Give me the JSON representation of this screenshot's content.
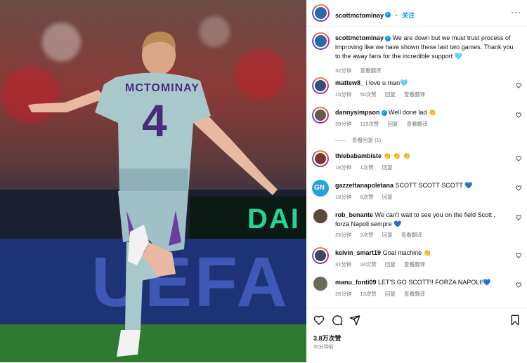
{
  "post": {
    "author": "scottmctominay",
    "follow_label": "关注",
    "caption": "We are down but we must trust process of improving like we have shown these last two games. Thank you to the away fans for the incredible support 🩵",
    "caption_time": "32分钟",
    "caption_translate": "查看翻译",
    "likes": "3.8万次赞",
    "time_ago": "32分钟前"
  },
  "photo": {
    "shirt_name": "MCTOMINAY",
    "shirt_number": "4",
    "board_text": "DAI",
    "ad_text": "UEFA"
  },
  "comments": [
    {
      "user": "mattew8_",
      "verified": false,
      "text": "i love u man🩵",
      "time": "15分钟",
      "likes": "50次赞",
      "reply": "回复",
      "translate": "查看翻译"
    },
    {
      "user": "dannysimpson",
      "verified": true,
      "text": "Well done lad 👏",
      "time": "28分钟",
      "likes": "115次赞",
      "reply": "回复",
      "translate": "查看翻译",
      "view_replies": "查看回复 (1)"
    },
    {
      "user": "thiebabambiste",
      "verified": false,
      "text": "👏 👏 👏",
      "time": "16分钟",
      "likes": "1次赞",
      "reply": "回复"
    },
    {
      "user": "gazzettanapoletana",
      "verified": false,
      "text": "SCOTT SCOTT SCOTT 💙",
      "time": "16分钟",
      "likes": "6次赞",
      "reply": "回复"
    },
    {
      "user": "rob_benante",
      "verified": false,
      "text": "We can't wait to see you on the field Scott , forza Napoli sempre 💙",
      "time": "25分钟",
      "likes": "2次赞",
      "reply": "回复",
      "translate": "查看翻译"
    },
    {
      "user": "kelvin_smart19",
      "verified": false,
      "text": "Goal machine 👏",
      "time": "31分钟",
      "likes": "24次赞",
      "reply": "回复",
      "translate": "查看翻译"
    },
    {
      "user": "manu_fonti09",
      "verified": false,
      "text": "LET'S GO SCOTT!! FORZA NAPOLI!💙",
      "time": "26分钟",
      "likes": "13次赞",
      "reply": "回复",
      "translate": "查看翻译"
    }
  ],
  "icons": [
    "heart-icon",
    "comment-icon",
    "share-icon",
    "bookmark-icon",
    "more-icon"
  ],
  "colors": {
    "accent": "#0095f6",
    "muted": "#737373"
  }
}
